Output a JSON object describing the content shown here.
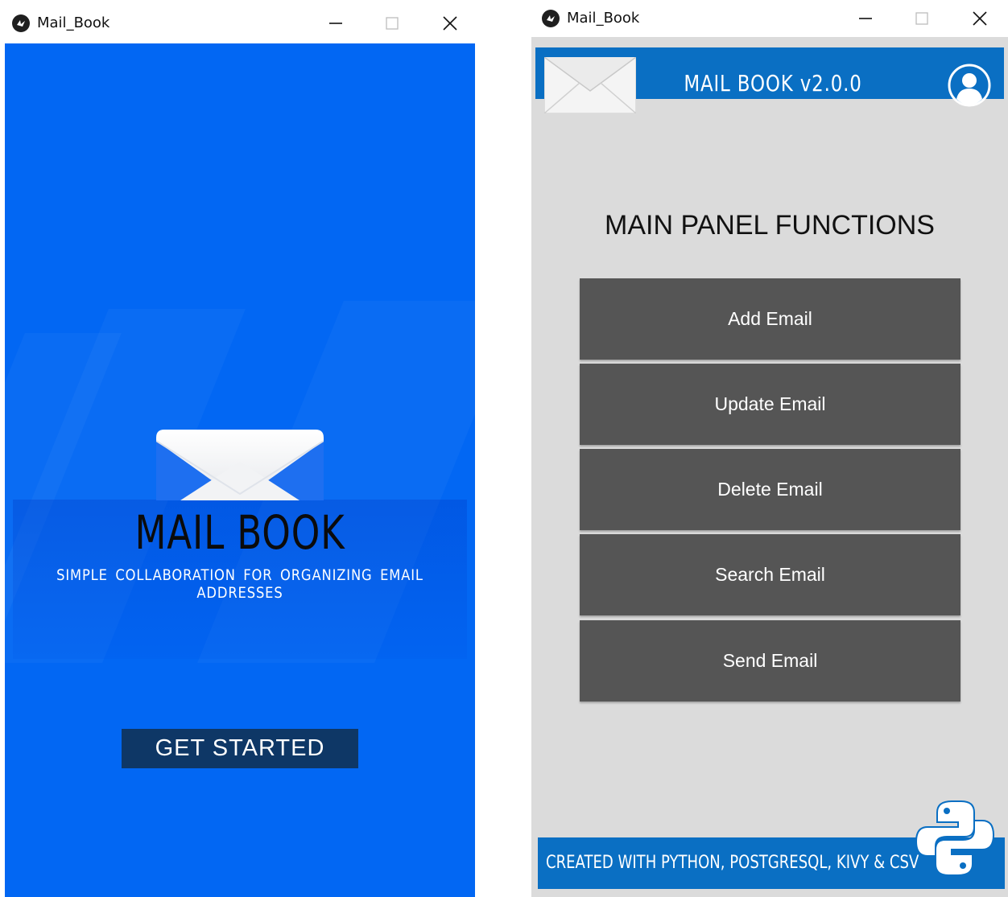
{
  "left_window": {
    "title": "Mail_Book",
    "splash_title": "MAIL BOOK",
    "splash_subtitle": "SIMPLE COLLABORATION FOR ORGANIZING EMAIL ADDRESSES",
    "get_started_label": "GET STARTED",
    "background_color": "#0267f3"
  },
  "right_window": {
    "title": "Mail_Book",
    "header_title": "MAIL BOOK v2.0.0",
    "panel_heading": "MAIN PANEL FUNCTIONS",
    "buttons": [
      {
        "label": "Add Email"
      },
      {
        "label": "Update Email"
      },
      {
        "label": "Delete Email"
      },
      {
        "label": "Search Email"
      },
      {
        "label": "Send Email"
      }
    ],
    "footer_text": "CREATED WITH PYTHON, POSTGRESQL, KIVY & CSV",
    "accent_color": "#0a6fc3",
    "button_color": "#555555"
  },
  "icons": [
    "kivy-app-icon",
    "minimize-icon",
    "maximize-icon",
    "close-icon",
    "envelope-icon",
    "user-icon",
    "python-logo-icon"
  ]
}
